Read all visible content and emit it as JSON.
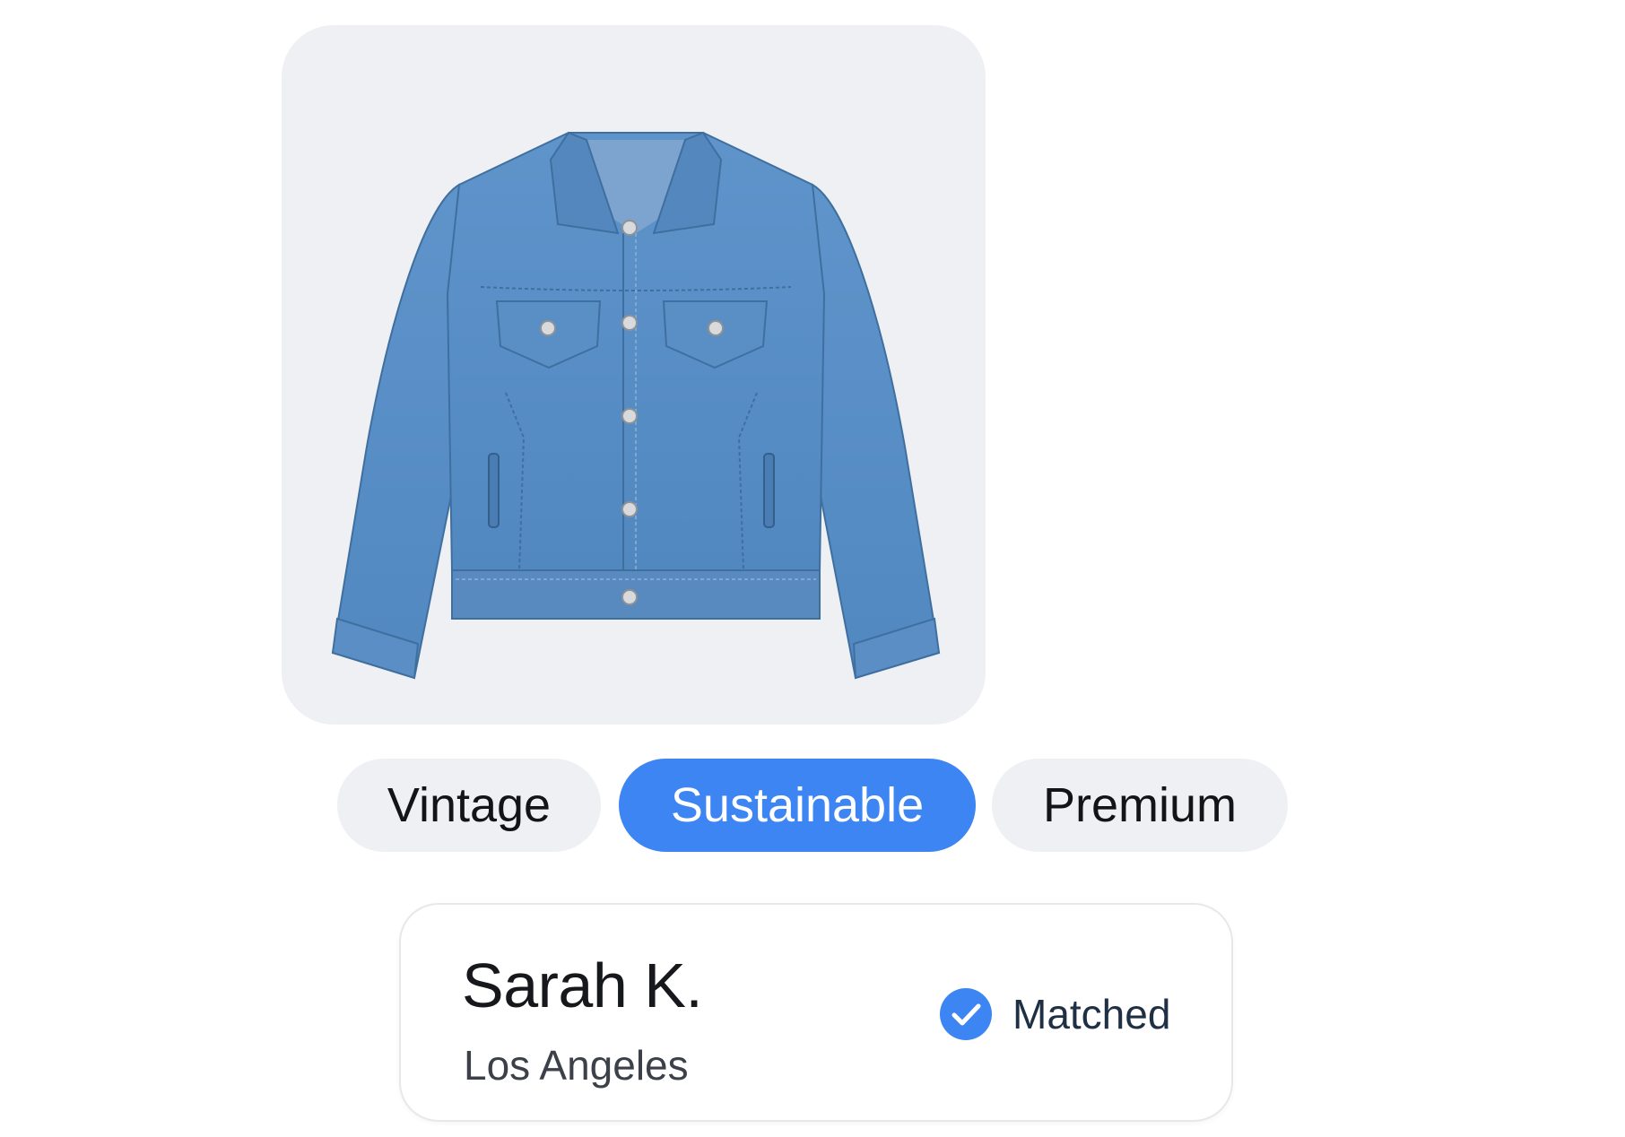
{
  "product": {
    "image_icon": "denim-jacket-image",
    "colors": {
      "card_background": "#eff0f3",
      "denim": "#5a8fc6"
    }
  },
  "tags": [
    {
      "label": "Vintage",
      "selected": false
    },
    {
      "label": "Sustainable",
      "selected": true
    },
    {
      "label": "Premium",
      "selected": false
    }
  ],
  "seller": {
    "name": "Sarah K.",
    "location": "Los Angeles",
    "status_icon": "check-circle-icon",
    "status_label": "Matched"
  },
  "colors": {
    "accent": "#3d85f2",
    "tag_background": "#eef0f4"
  }
}
